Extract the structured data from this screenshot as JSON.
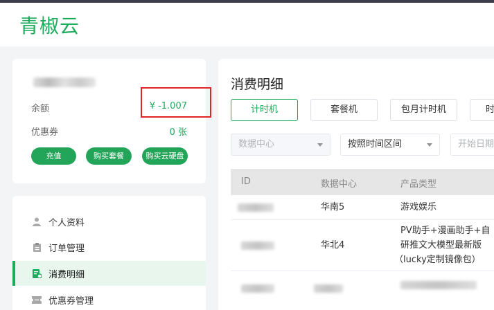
{
  "brand": {
    "logo_text": "青椒云",
    "color": "#1aab5b"
  },
  "account": {
    "balance_label": "余额",
    "balance_value": "¥ -1.007",
    "coupon_label": "优惠券",
    "coupon_value": "0 张",
    "buttons": [
      "充值",
      "购买套餐",
      "购买云硬盘"
    ]
  },
  "nav": {
    "items": [
      {
        "label": "个人资料",
        "icon": "user-icon"
      },
      {
        "label": "订单管理",
        "icon": "clipboard-icon"
      },
      {
        "label": "消费明细",
        "icon": "receipt-icon"
      },
      {
        "label": "优惠券管理",
        "icon": "ticket-icon"
      }
    ],
    "active": "消费明细"
  },
  "main": {
    "title": "消费明细",
    "tabs": [
      "计时机",
      "套餐机",
      "包月计时机",
      "时"
    ],
    "active_tab": "计时机",
    "filters": {
      "datacenter_placeholder": "数据中心",
      "range_value": "按照时间区间",
      "start_date_placeholder": "开始日期"
    },
    "table": {
      "columns": [
        "ID",
        "数据中心",
        "产品类型"
      ],
      "rows": [
        {
          "id": "",
          "datacenter": "华南5",
          "product": "游戏娱乐"
        },
        {
          "id": "",
          "datacenter": "华北4",
          "product_lines": [
            "PV助手+漫画助手+自",
            "研推文大模型最新版",
            "（lucky定制镜像包）"
          ]
        },
        {
          "id": "",
          "datacenter": "",
          "product": ""
        }
      ]
    }
  }
}
